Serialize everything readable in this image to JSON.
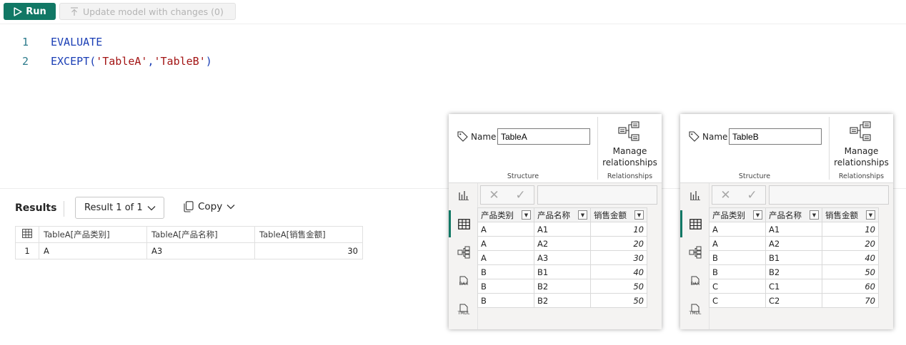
{
  "toolbar": {
    "run_label": "Run",
    "update_label": "Update model with changes (0)"
  },
  "editor": {
    "lines": [
      {
        "num": "1",
        "tokens": [
          {
            "text": "EVALUATE",
            "kind": "kw"
          }
        ]
      },
      {
        "num": "2",
        "tokens": [
          {
            "text": "EXCEPT",
            "kind": "kw"
          },
          {
            "text": "(",
            "kind": "punc"
          },
          {
            "text": "'TableA'",
            "kind": "str"
          },
          {
            "text": ",",
            "kind": "punc"
          },
          {
            "text": "'TableB'",
            "kind": "str"
          },
          {
            "text": ")",
            "kind": "punc"
          }
        ]
      }
    ]
  },
  "results": {
    "title": "Results",
    "selector": "Result 1 of 1",
    "copy_label": "Copy",
    "columns": [
      "TableA[产品类别]",
      "TableA[产品名称]",
      "TableA[销售金额]"
    ],
    "rows": [
      {
        "index": "1",
        "cells": [
          "A",
          "A3",
          "30"
        ]
      }
    ]
  },
  "panels": [
    {
      "name_label": "Name",
      "name_value": "TableA",
      "structure_label": "Structure",
      "manage_label_1": "Manage",
      "manage_label_2": "relationships",
      "relationships_label": "Relationships",
      "columns": [
        "产品类别",
        "产品名称",
        "销售金额"
      ],
      "rows": [
        [
          "A",
          "A1",
          "10"
        ],
        [
          "A",
          "A2",
          "20"
        ],
        [
          "A",
          "A3",
          "30"
        ],
        [
          "B",
          "B1",
          "40"
        ],
        [
          "B",
          "B2",
          "50"
        ],
        [
          "B",
          "B2",
          "50"
        ]
      ]
    },
    {
      "name_label": "Name",
      "name_value": "TableB",
      "structure_label": "Structure",
      "manage_label_1": "Manage",
      "manage_label_2": "relationships",
      "relationships_label": "Relationships",
      "columns": [
        "产品类别",
        "产品名称",
        "销售金额"
      ],
      "rows": [
        [
          "A",
          "A1",
          "10"
        ],
        [
          "A",
          "A2",
          "20"
        ],
        [
          "B",
          "B1",
          "40"
        ],
        [
          "B",
          "B2",
          "50"
        ],
        [
          "C",
          "C1",
          "60"
        ],
        [
          "C",
          "C2",
          "70"
        ]
      ]
    }
  ],
  "side_icons": [
    "report-view-icon",
    "table-view-icon",
    "model-view-icon",
    "dax-query-view-icon",
    "tmdl-view-icon"
  ],
  "side_icon_text": {
    "dax": "DAX",
    "tmdl": "TMDL"
  },
  "colors": {
    "accent": "#117865",
    "keyword": "#1a3eb5",
    "string": "#a31515",
    "line_number": "#2b7a8b"
  }
}
